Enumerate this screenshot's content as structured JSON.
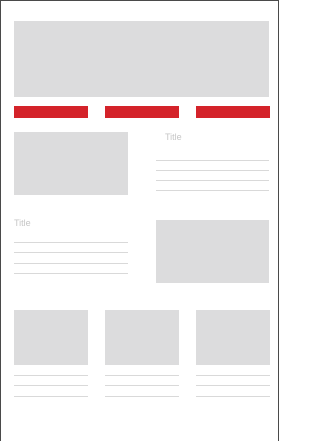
{
  "colors": {
    "placeholder": "#dcdcdd",
    "accent": "#d4232a",
    "rule": "#d9d9d9",
    "title_text": "#c6c6c6"
  },
  "hero": {
    "icon": "image-placeholder"
  },
  "nav": {
    "items": [
      {
        "label": ""
      },
      {
        "label": ""
      },
      {
        "label": ""
      }
    ]
  },
  "feature_1": {
    "title": "Title",
    "icon": "image-placeholder"
  },
  "feature_2": {
    "title": "Title",
    "icon": "image-placeholder"
  },
  "cards": [
    {
      "icon": "image-placeholder"
    },
    {
      "icon": "image-placeholder"
    },
    {
      "icon": "image-placeholder"
    }
  ]
}
